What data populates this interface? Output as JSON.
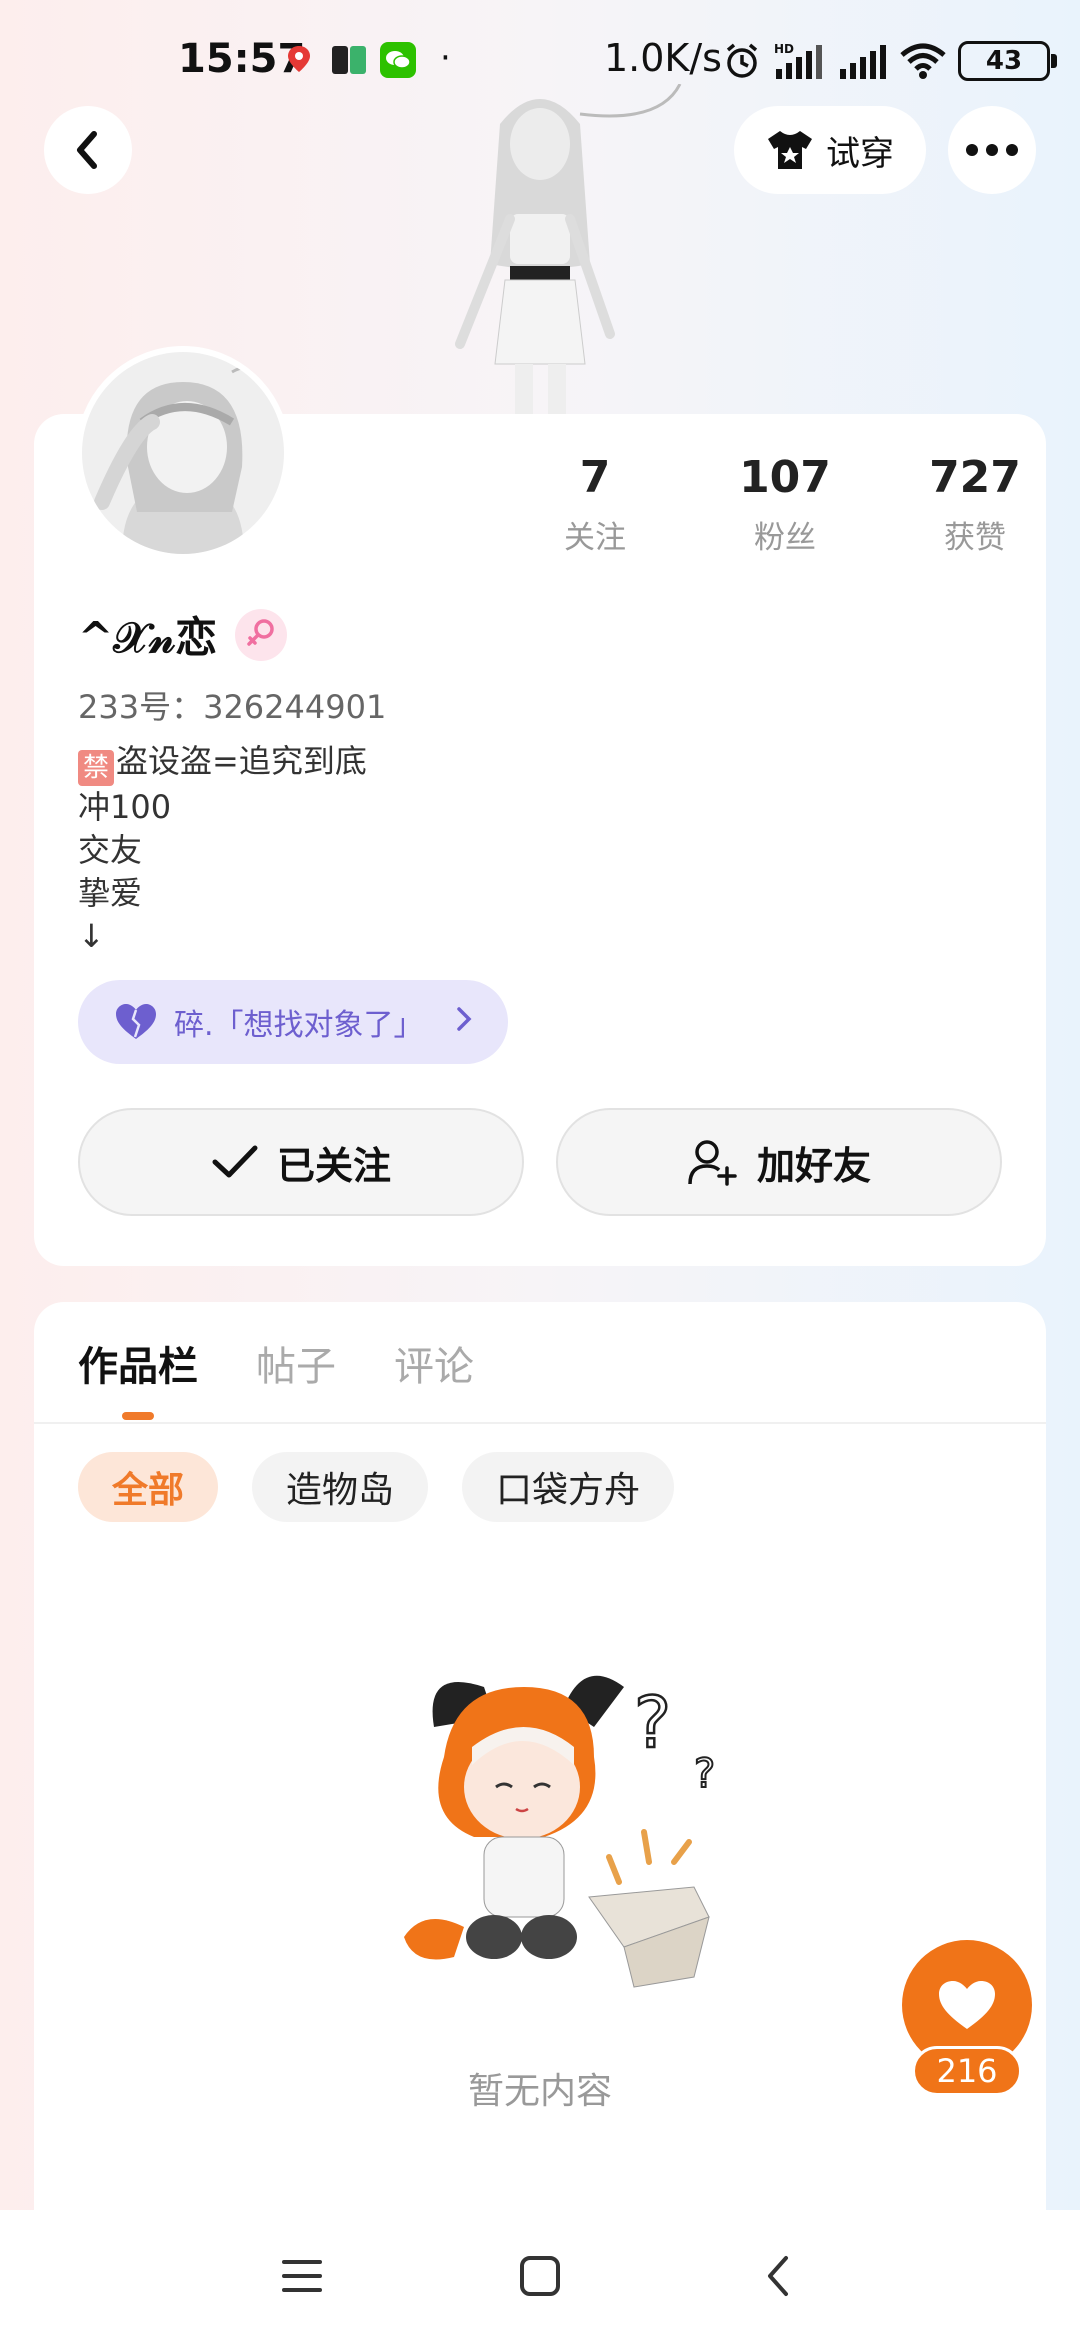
{
  "status_bar": {
    "time": "15:57",
    "network_speed": "1.0K/s",
    "battery": "43"
  },
  "header": {
    "try_on_label": "试穿"
  },
  "profile": {
    "stats": [
      {
        "value": "7",
        "label": "关注"
      },
      {
        "value": "107",
        "label": "粉丝"
      },
      {
        "value": "727",
        "label": "获赞"
      }
    ],
    "username": "^𝒳𝓃恋",
    "user_id": "233号：326244901",
    "bio_ban_badge": "禁",
    "bio_lines": [
      "盗设盗=追究到底",
      "冲100",
      "交友",
      "挚爱",
      "↓"
    ],
    "status_pill": "碎.「想找对象了」",
    "follow_label": "已关注",
    "add_friend_label": "加好友"
  },
  "works": {
    "tabs": [
      "作品栏",
      "帖子",
      "评论"
    ],
    "chips": [
      "全部",
      "造物岛",
      "口袋方舟"
    ],
    "empty_text": "暂无内容"
  },
  "like": {
    "count": "216"
  },
  "colors": {
    "accent_orange": "#f07418",
    "status_purple": "#6d5fcf"
  }
}
